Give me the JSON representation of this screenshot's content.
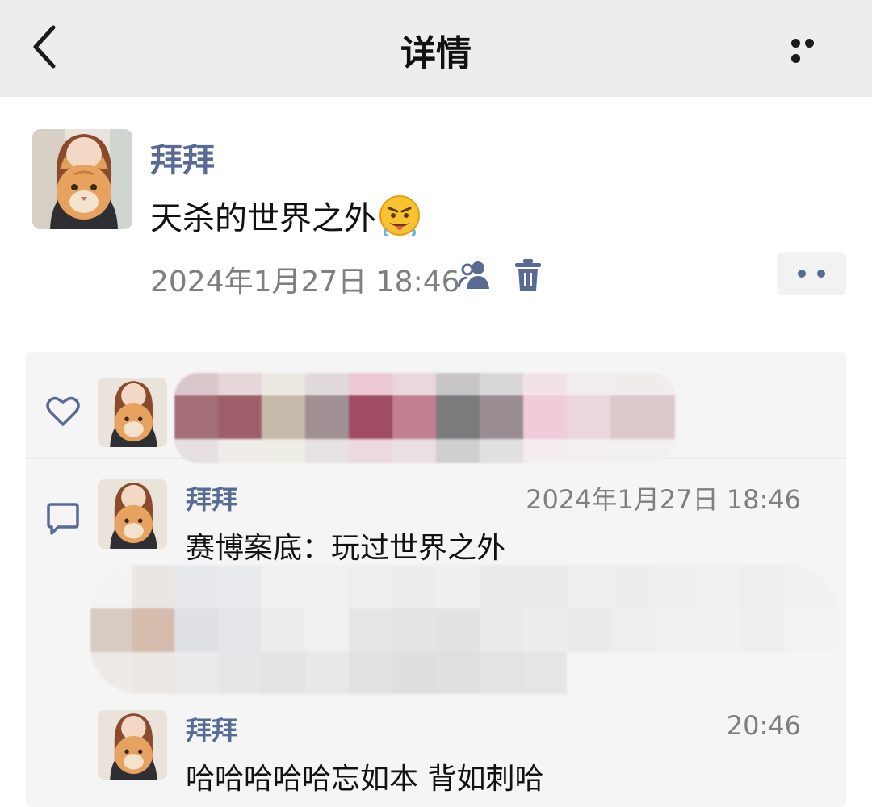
{
  "header": {
    "title": "详情",
    "back_icon": "chevron-left-icon",
    "more_icon": "more-horizontal-icon"
  },
  "post": {
    "author": "拜拜",
    "text": "天杀的世界之外",
    "emoji": "zany-face-emoji",
    "time": "2024年1月27日 18:46",
    "visibility_icon": "people-icon",
    "delete_icon": "trash-icon",
    "more_icon": "dots-icon"
  },
  "likes": {
    "icon": "heart-outline-icon",
    "names_obscured": true
  },
  "comments": [
    {
      "author": "拜拜",
      "time": "2024年1月27日 18:46",
      "text": "赛博案底：玩过世界之外"
    },
    {
      "author": "",
      "time": "",
      "text": "",
      "obscured": true
    },
    {
      "author": "拜拜",
      "time": "20:46",
      "text": "哈哈哈哈哈忘如本 背如刺哈"
    }
  ],
  "colors": {
    "link_blue": "#576b95",
    "topbar_bg": "#ededed",
    "panel_bg": "#f5f5f5",
    "muted": "#7f7f7f"
  }
}
